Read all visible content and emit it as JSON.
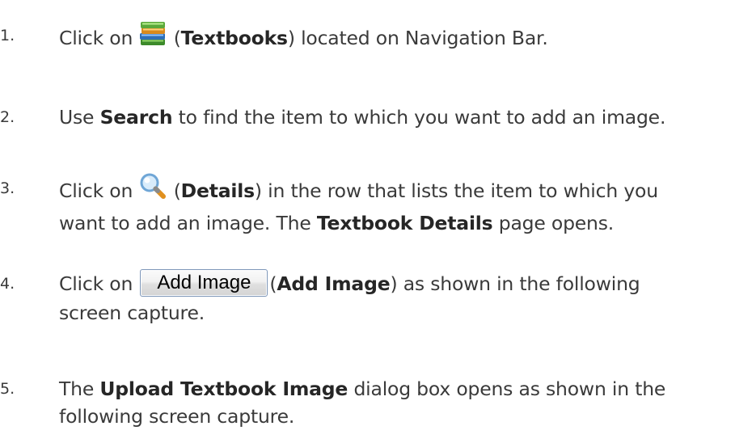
{
  "steps": [
    {
      "number": "1.",
      "before": "Click on",
      "icon": "textbooks-icon",
      "paren_open": "(",
      "bold": "Textbooks",
      "paren_close": ")",
      "after": " located on Navigation Bar."
    },
    {
      "number": "2.",
      "before": "Use ",
      "bold": "Search",
      "after": " to find the item to which you want to add an image."
    },
    {
      "number": "3.",
      "before": "Click on",
      "icon": "details-magnifier-icon",
      "paren_open": "(",
      "bold": "Details",
      "paren_close": ")",
      "after": " in the row that lists the item to which you",
      "line2_before": "want to add an image. The ",
      "line2_bold": "Textbook Details",
      "line2_after": " page opens."
    },
    {
      "number": "4.",
      "before": "Click on",
      "button_label": "Add Image",
      "paren_open": "(",
      "bold": "Add Image",
      "paren_close": ")",
      "after": " as shown in the following",
      "line2": "screen capture."
    },
    {
      "number": "5.",
      "before": "The ",
      "bold": "Upload Textbook Image",
      "after": " dialog box opens as shown in the",
      "line2": "following screen capture."
    }
  ]
}
